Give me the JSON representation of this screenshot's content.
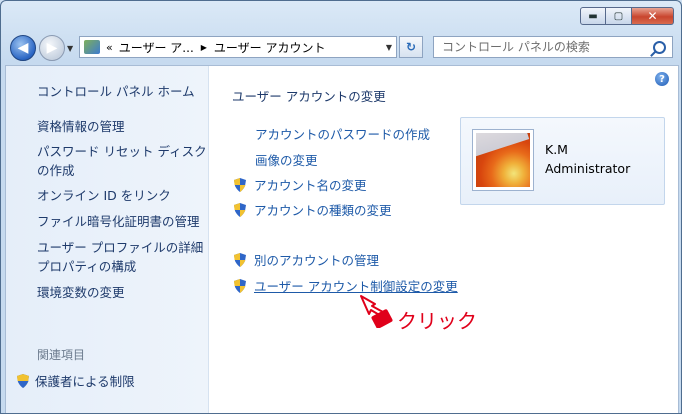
{
  "window": {
    "caption_buttons": {
      "minimize": "▬",
      "maximize": "▢",
      "close": "✕"
    }
  },
  "navbar": {
    "back_glyph": "◀",
    "forward_glyph": "▶",
    "address": {
      "overflow": "«",
      "segments": [
        "ユーザー ア...",
        "ユーザー アカウント"
      ],
      "separator_glyph": "▶"
    },
    "refresh_glyph": "↻",
    "search": {
      "placeholder": "コントロール パネルの検索"
    }
  },
  "sidebar": {
    "home": "コントロール パネル ホーム",
    "links": [
      "資格情報の管理",
      "パスワード リセット ディスク\nの作成",
      "オンライン ID をリンク",
      "ファイル暗号化証明書の管理",
      "ユーザー プロファイルの詳細\nプロパティの構成",
      "環境変数の変更"
    ],
    "related_heading": "関連項目",
    "related_link": "保護者による制限"
  },
  "main": {
    "title": "ユーザー アカウントの変更",
    "tasks": [
      {
        "label": "アカウントのパスワードの作成",
        "shield": false
      },
      {
        "label": "画像の変更",
        "shield": false
      },
      {
        "label": "アカウント名の変更",
        "shield": true
      },
      {
        "label": "アカウントの種類の変更",
        "shield": true
      },
      {
        "label": "別のアカウントの管理",
        "shield": true
      },
      {
        "label": "ユーザー アカウント制御設定の変更",
        "shield": true
      }
    ],
    "user": {
      "name": "K.M",
      "role": "Administrator"
    },
    "help_glyph": "?"
  },
  "annotation": {
    "label": "クリック",
    "color": "#e0001a"
  },
  "colors": {
    "link": "#1e5aa8",
    "heading": "#1e3a6b",
    "sidebar_bg": "#e5eef9"
  }
}
